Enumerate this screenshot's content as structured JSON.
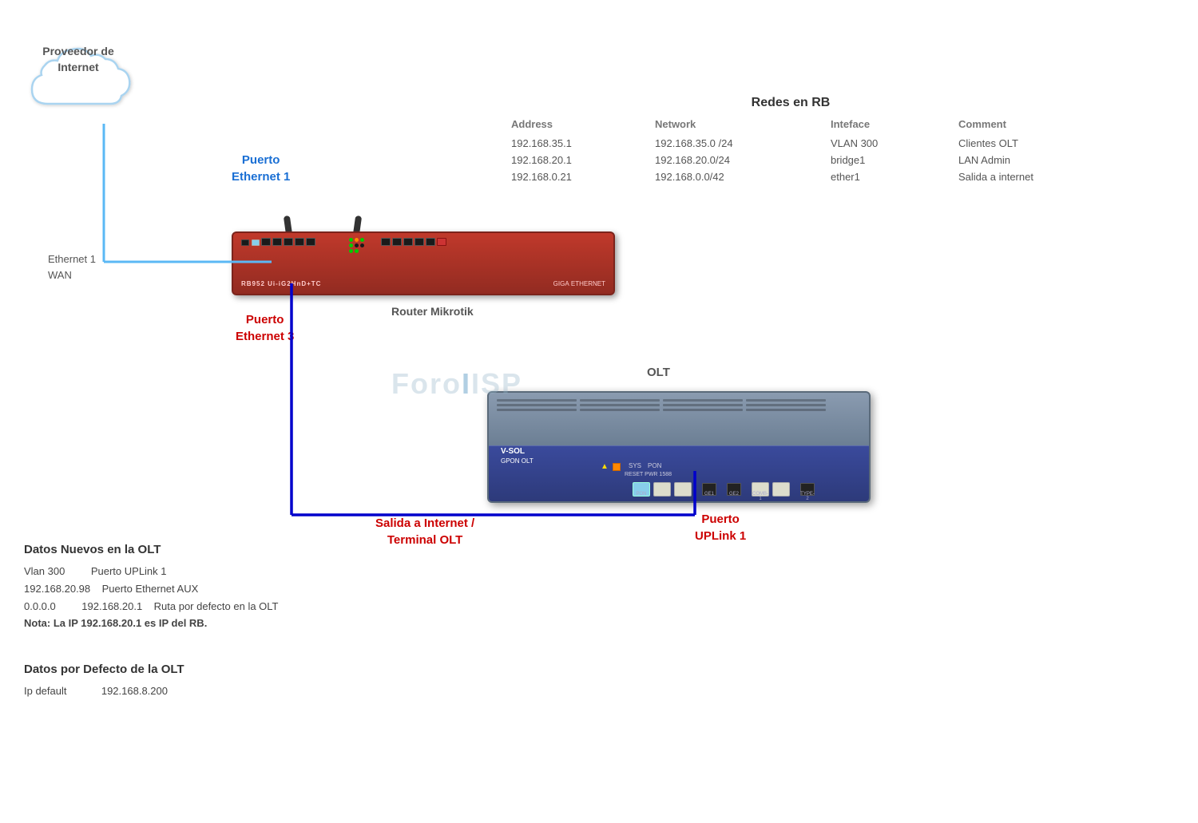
{
  "cloud": {
    "label_line1": "Proveedor de",
    "label_line2": "Internet"
  },
  "labels": {
    "ethernet1_wan_line1": "Ethernet 1",
    "ethernet1_wan_line2": "WAN",
    "puerto_eth1_line1": "Puerto",
    "puerto_eth1_line2": "Ethernet 1",
    "puerto_eth3_line1": "Puerto",
    "puerto_eth3_line2": "Ethernet 3",
    "router_label": "Router Mikrotik",
    "olt_label": "OLT",
    "salida_line1": "Salida a Internet /",
    "salida_line2": "Terminal  OLT",
    "puerto_uplink_line1": "Puerto",
    "puerto_uplink_line2": "UPLink 1"
  },
  "redes": {
    "title": "Redes en RB",
    "headers": {
      "address": "Address",
      "network": "Network",
      "interface": "Inteface",
      "comment": "Comment"
    },
    "rows": [
      {
        "address": "192.168.35.1",
        "network": "192.168.35.0 /24",
        "interface": "VLAN 300",
        "comment": "Clientes OLT"
      },
      {
        "address": "192.168.20.1",
        "network": "192.168.20.0/24",
        "interface": "bridge1",
        "comment": "LAN Admin"
      },
      {
        "address": "192.168.0.21",
        "network": "192.168.0.0/42",
        "interface": "ether1",
        "comment": "Salida a internet"
      }
    ]
  },
  "datos_nuevos": {
    "title": "Datos Nuevos en  la OLT",
    "rows": [
      {
        "col1": "Vlan 300",
        "col2": "Puerto UPLink 1",
        "col3": ""
      },
      {
        "col1": "192.168.20.98",
        "col2": "Puerto Ethernet AUX",
        "col3": ""
      },
      {
        "col1": "0.0.0.0",
        "col2": "192.168.20.1",
        "col3": "Ruta  por defecto en la OLT"
      }
    ],
    "nota": "Nota: La IP 192.168.20.1 es IP del RB."
  },
  "datos_defecto": {
    "title": "Datos por Defecto de la OLT",
    "ip_label": "Ip default",
    "ip_value": "192.168.8.200"
  },
  "watermark": {
    "text_foro": "Foro",
    "text_isp": "ISP"
  }
}
